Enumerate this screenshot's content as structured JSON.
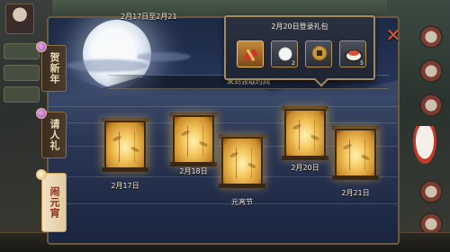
{
  "header": {
    "date_range": "2月17日至2月21"
  },
  "tabs": [
    {
      "label": "贺新年",
      "active": false
    },
    {
      "label": "请人礼",
      "active": false
    },
    {
      "label": "闹元宵",
      "active": true
    }
  ],
  "section": {
    "title": "未到领取时间"
  },
  "lanterns": [
    {
      "label": "2月17日"
    },
    {
      "label": "2月18日"
    },
    {
      "label": "元宵节"
    },
    {
      "label": "2月20日"
    },
    {
      "label": "2月21日"
    }
  ],
  "popup": {
    "title": "2月20日登录礼包",
    "items": [
      {
        "icon": "firecracker-icon",
        "qty": "",
        "rare": true
      },
      {
        "icon": "pearl-icon",
        "qty": "2",
        "rare": false
      },
      {
        "icon": "coin-icon",
        "qty": "",
        "sub": "",
        "rare": false
      },
      {
        "icon": "sushi-icon",
        "qty": "5",
        "rare": false
      }
    ]
  },
  "colors": {
    "accent_gold": "#a68a5b",
    "close_orange": "#e05a2a",
    "lantern_glow": "#f3c45a"
  }
}
